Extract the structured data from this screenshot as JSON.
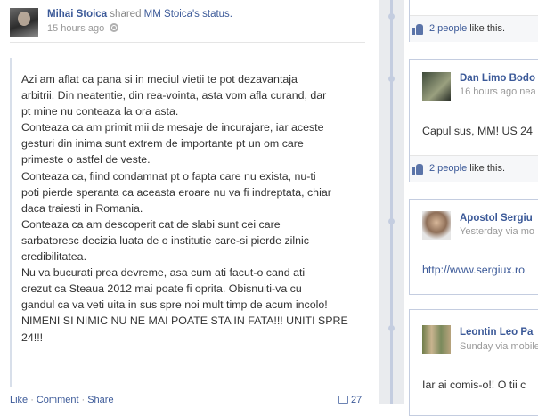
{
  "post": {
    "actor": "Mihai Stoica",
    "verb": " shared ",
    "shared_from": "MM Stoica's status.",
    "time": "15 hours ago",
    "message_lines": [
      "Azi am aflat ca pana si in meciul vietii te pot dezavantaja",
      "arbitrii. Din neatentie, din rea-vointa, asta vom afla curand, dar",
      "pt mine nu conteaza la ora asta.",
      "Conteaza ca am primit mii de mesaje de incurajare, iar aceste",
      "gesturi din inima sunt extrem de importante pt un om care",
      "primeste o astfel de veste.",
      "Conteaza ca, fiind condamnat pt o fapta care nu exista, nu-ti",
      "poti pierde speranta ca aceasta eroare nu va fi indreptata, chiar",
      "daca traiesti in Romania.",
      "Conteaza ca am descoperit cat de slabi sunt cei care",
      "sarbatoresc decizia luata de o institutie care-si pierde zilnic",
      "credibilitatea.",
      "Nu va bucurati prea devreme, asa cum ati facut-o cand ati",
      "crezut ca Steaua 2012 mai poate fi oprita. Obisnuiti-va cu",
      "gandul ca va veti uita in sus spre noi mult timp de acum incolo!",
      "NIMENI SI NIMIC NU NE MAI POATE STA IN FATA!!! UNITI SPRE",
      "24!!!"
    ],
    "actions": {
      "like": "Like",
      "comment": "Comment",
      "share": "Share",
      "sep": "·"
    },
    "comment_count": "27"
  },
  "cards": [
    {
      "likes_link": "2 people",
      "likes_suffix": " like this."
    },
    {
      "name": "Dan Limo Bodo",
      "time": "16 hours ago nea",
      "text": "Capul sus, MM! US 24",
      "likes_link": "2 people",
      "likes_suffix": " like this."
    },
    {
      "name": "Apostol Sergiu",
      "time": "Yesterday via mo",
      "link": "http://www.sergiux.ro"
    },
    {
      "name": "Leontin Leo Pa",
      "time": "Sunday via mobile",
      "text": "Iar ai comis-o!! O tii c"
    }
  ]
}
